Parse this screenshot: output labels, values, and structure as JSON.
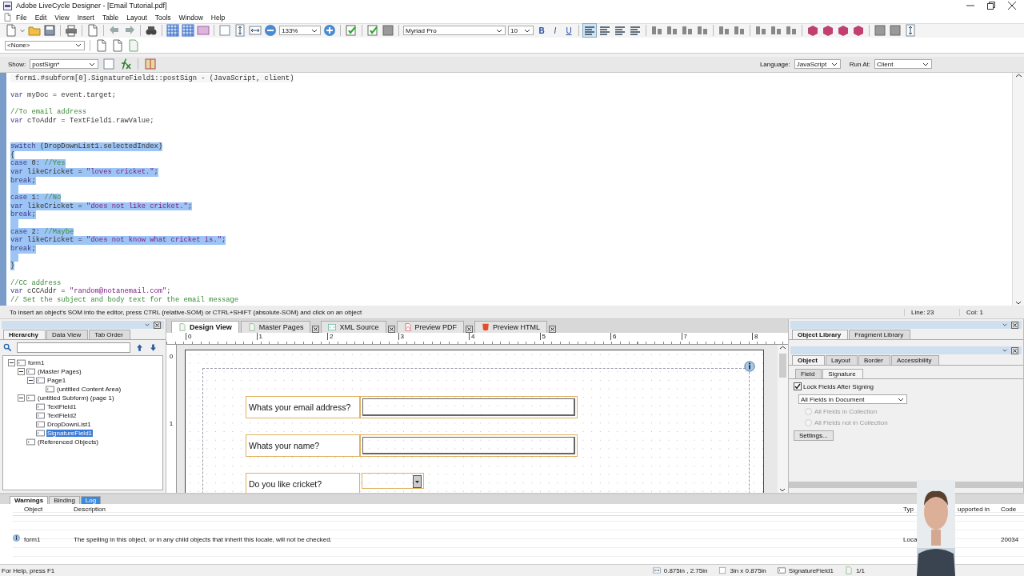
{
  "window": {
    "title": "Adobe LiveCycle Designer - [Email Tutorial.pdf]"
  },
  "menu": [
    "File",
    "Edit",
    "View",
    "Insert",
    "Table",
    "Layout",
    "Tools",
    "Window",
    "Help"
  ],
  "toolbar": {
    "zoom": "133%",
    "font": "Myriad Pro",
    "size": "10",
    "bold": "B",
    "italic": "I",
    "underline": "U",
    "style": "<None>",
    "alignment": [
      {
        "selected": true
      },
      {
        "selected": false
      },
      {
        "selected": false
      },
      {
        "selected": false
      }
    ]
  },
  "script": {
    "show_label": "Show:",
    "show": "postSign*",
    "language_label": "Language:",
    "language": "JavaScript",
    "run_at_label": "Run At:",
    "run_at": "Client",
    "header": "form1.#subform[0].SignatureField1::postSign - (JavaScript, client)",
    "lines": [
      {
        "selected": false
      },
      {
        "selected": false,
        "segments": [
          {
            "kind": "keyword",
            "text": "var"
          },
          {
            "kind": "plain",
            "text": " myDoc = event.target;"
          }
        ]
      },
      {
        "selected": false
      },
      {
        "selected": false,
        "segments": [
          {
            "kind": "comment",
            "text": "//To email address"
          }
        ]
      },
      {
        "selected": false,
        "segments": [
          {
            "kind": "keyword",
            "text": "var"
          },
          {
            "kind": "plain",
            "text": " cToAddr = TextField1.rawValue;"
          }
        ]
      },
      {
        "selected": false
      },
      {
        "selected": false
      },
      {
        "selected": true,
        "segments": [
          {
            "kind": "keyword",
            "text": "switch"
          },
          {
            "kind": "plain",
            "text": " (DropDownList1.selectedIndex)"
          }
        ]
      },
      {
        "selected": true,
        "segments": [
          {
            "kind": "plain",
            "text": "{"
          }
        ]
      },
      {
        "selected": true,
        "segments": [
          {
            "kind": "keyword",
            "text": "case"
          },
          {
            "kind": "plain",
            "text": " 0: "
          },
          {
            "kind": "comment",
            "text": "//Yes"
          }
        ]
      },
      {
        "selected": true,
        "segments": [
          {
            "kind": "keyword",
            "text": "var"
          },
          {
            "kind": "plain",
            "text": " likeCricket = "
          },
          {
            "kind": "string",
            "text": "\"loves cricket.\""
          },
          {
            "kind": "plain",
            "text": ";"
          }
        ]
      },
      {
        "selected": true,
        "segments": [
          {
            "kind": "keyword",
            "text": "break"
          },
          {
            "kind": "plain",
            "text": ";"
          }
        ]
      },
      {
        "selected": true
      },
      {
        "selected": true,
        "segments": [
          {
            "kind": "keyword",
            "text": "case"
          },
          {
            "kind": "plain",
            "text": " 1: "
          },
          {
            "kind": "comment",
            "text": "//No"
          }
        ]
      },
      {
        "selected": true,
        "segments": [
          {
            "kind": "keyword",
            "text": "var"
          },
          {
            "kind": "plain",
            "text": " likeCricket = "
          },
          {
            "kind": "string",
            "text": "\"does not like cricket.\""
          },
          {
            "kind": "plain",
            "text": ";"
          }
        ]
      },
      {
        "selected": true,
        "segments": [
          {
            "kind": "keyword",
            "text": "break"
          },
          {
            "kind": "plain",
            "text": ";"
          }
        ]
      },
      {
        "selected": true
      },
      {
        "selected": true,
        "segments": [
          {
            "kind": "keyword",
            "text": "case"
          },
          {
            "kind": "plain",
            "text": " 2: "
          },
          {
            "kind": "comment",
            "text": "//Maybe"
          }
        ]
      },
      {
        "selected": true,
        "segments": [
          {
            "kind": "keyword",
            "text": "var"
          },
          {
            "kind": "plain",
            "text": " likeCricket = "
          },
          {
            "kind": "string",
            "text": "\"does not know what cricket is.\""
          },
          {
            "kind": "plain",
            "text": ";"
          }
        ]
      },
      {
        "selected": true,
        "segments": [
          {
            "kind": "keyword",
            "text": "break"
          },
          {
            "kind": "plain",
            "text": ";"
          }
        ]
      },
      {
        "selected": true
      },
      {
        "selected": true,
        "segments": [
          {
            "kind": "plain",
            "text": "}"
          }
        ]
      },
      {
        "selected": false
      },
      {
        "selected": false,
        "segments": [
          {
            "kind": "comment",
            "text": "//CC address"
          }
        ]
      },
      {
        "selected": false,
        "segments": [
          {
            "kind": "keyword",
            "text": "var"
          },
          {
            "kind": "plain",
            "text": " cCCAddr = "
          },
          {
            "kind": "string",
            "text": "\"random@notanemail.com\""
          },
          {
            "kind": "plain",
            "text": ";"
          }
        ]
      },
      {
        "selected": false,
        "segments": [
          {
            "kind": "comment",
            "text": "// Set the subject and body text for the email message"
          }
        ]
      }
    ],
    "hint": "To insert an object's SOM into the editor, press CTRL (relative-SOM) or CTRL+SHIFT (absolute-SOM) and click on an object",
    "line": "Line: 23",
    "col": "Col: 1"
  },
  "hierarchy": {
    "tabs": [
      {
        "label": "Hierarchy",
        "selected": true
      },
      {
        "label": "Data View",
        "selected": false
      },
      {
        "label": "Tab Order",
        "selected": false
      }
    ],
    "tree": [
      {
        "label": "form1",
        "expanded": true,
        "selected": false,
        "children": [
          {
            "label": "(Master Pages)",
            "expanded": true,
            "selected": false,
            "children": [
              {
                "label": "Page1",
                "expanded": true,
                "selected": false,
                "children": [
                  {
                    "label": "(untitled Content Area)",
                    "selected": false
                  }
                ]
              }
            ]
          },
          {
            "label": "(untitled Subform) (page 1)",
            "expanded": true,
            "selected": false,
            "children": [
              {
                "label": "TextField1",
                "selected": false
              },
              {
                "label": "TextField2",
                "selected": false
              },
              {
                "label": "DropDownList1",
                "selected": false
              },
              {
                "label": "SignatureField1",
                "selected": true
              }
            ]
          },
          {
            "label": "(Referenced Objects)",
            "selected": false
          }
        ]
      }
    ]
  },
  "design": {
    "tabs": [
      {
        "label": "Design View",
        "selected": true
      },
      {
        "label": "Master Pages",
        "selected": false
      },
      {
        "label": "XML Source",
        "selected": false
      },
      {
        "label": "Preview PDF",
        "selected": false
      },
      {
        "label": "Preview HTML",
        "selected": false
      }
    ],
    "ruler": [
      "0",
      "1",
      "2",
      "3",
      "4",
      "5",
      "6",
      "7",
      "8"
    ],
    "vruler": [
      "0",
      "1"
    ],
    "fields": [
      {
        "label": "Whats your email address?",
        "kind": "text"
      },
      {
        "label": "Whats your name?",
        "kind": "text"
      },
      {
        "label": "Do you like cricket?",
        "kind": "dropdown"
      }
    ]
  },
  "properties": {
    "library_tabs": [
      {
        "label": "Object Library",
        "selected": true
      },
      {
        "label": "Fragment Library",
        "selected": false
      }
    ],
    "object_tabs": [
      {
        "label": "Object",
        "selected": true
      },
      {
        "label": "Layout",
        "selected": false
      },
      {
        "label": "Border",
        "selected": false
      },
      {
        "label": "Accessibility",
        "selected": false
      }
    ],
    "sub_tabs": [
      {
        "label": "Field",
        "selected": false
      },
      {
        "label": "Signature",
        "selected": true
      }
    ],
    "lock": {
      "label": "Lock Fields After Signing",
      "checked": true
    },
    "scope": "All Fields in Document",
    "radios": [
      {
        "label": "All Fields in Collection",
        "selected": false,
        "disabled": true
      },
      {
        "label": "All Fields not in Collection",
        "selected": false,
        "disabled": true
      }
    ],
    "settings": "Settings..."
  },
  "warnings": {
    "tabs": [
      {
        "label": "Warnings",
        "selected": true,
        "highlighted": false
      },
      {
        "label": "Binding",
        "selected": false,
        "highlighted": false
      },
      {
        "label": "Log",
        "selected": false,
        "highlighted": true
      }
    ],
    "columns": [
      "Object",
      "Description",
      "Typ",
      "upported in",
      "Code"
    ],
    "rows": [
      {
        "object": "form1",
        "description": "The spelling in this object, or in any child objects that inherit this locale, will not be checked.",
        "type": "Loca",
        "code": "20034"
      }
    ]
  },
  "status_bar": {
    "help": "For Help, press F1",
    "position": "0.875in , 2.75in",
    "size": "3in x 0.875in",
    "object": "SignatureField1",
    "page": "1/1"
  }
}
